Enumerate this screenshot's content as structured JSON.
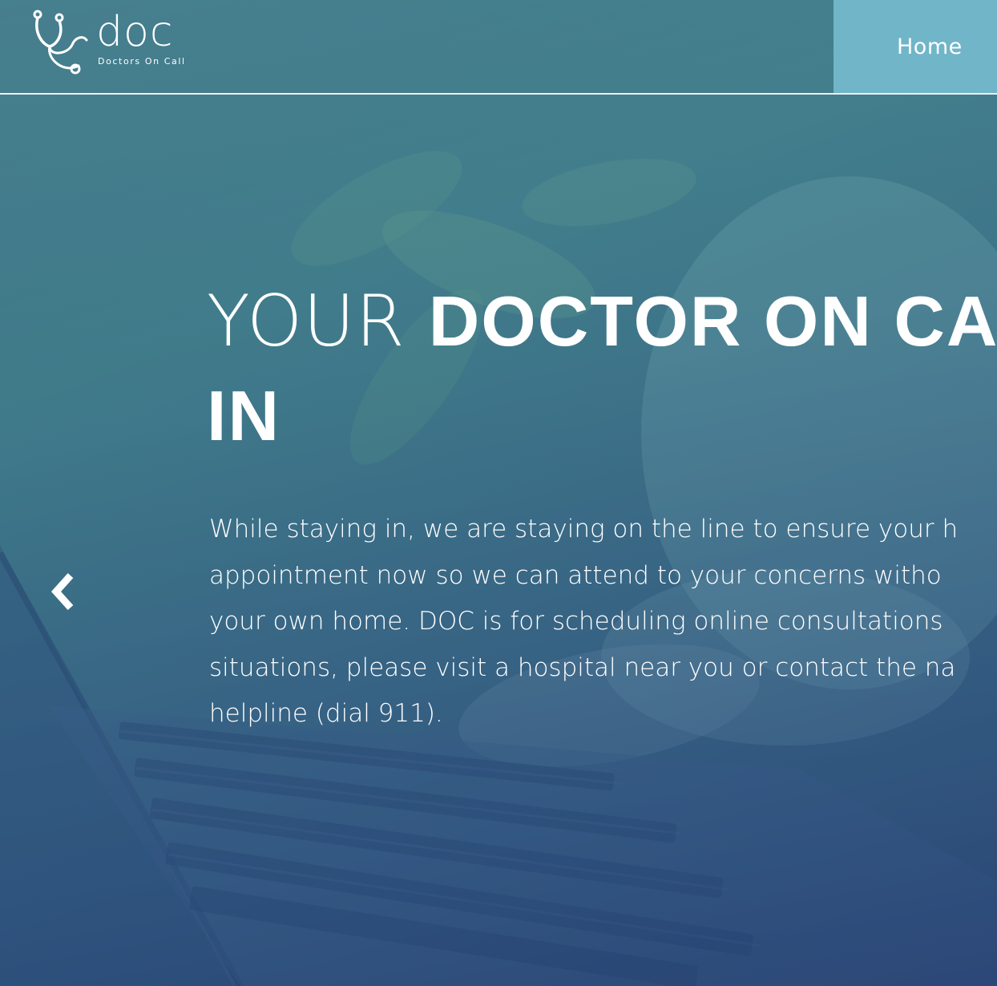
{
  "brand": {
    "logo_text": "doc",
    "tagline": "Doctors On Call"
  },
  "nav": {
    "home_label": "Home"
  },
  "hero": {
    "title_light": "YOUR ",
    "title_bold_line1": "DOCTOR ON CA",
    "title_bold_line2": "IN",
    "paragraph_lines": [
      "While staying in, we are staying on the line to ensure your h",
      "appointment now so we can attend to your concerns witho",
      "your own home. DOC is for scheduling online consultations",
      "situations, please visit a hospital near you or contact the na",
      "helpline (dial 911)."
    ]
  },
  "carousel": {
    "prev_icon": "chevron-left-icon"
  },
  "colors": {
    "nav_active_bg": "#71b5c8",
    "text": "#ffffff"
  }
}
